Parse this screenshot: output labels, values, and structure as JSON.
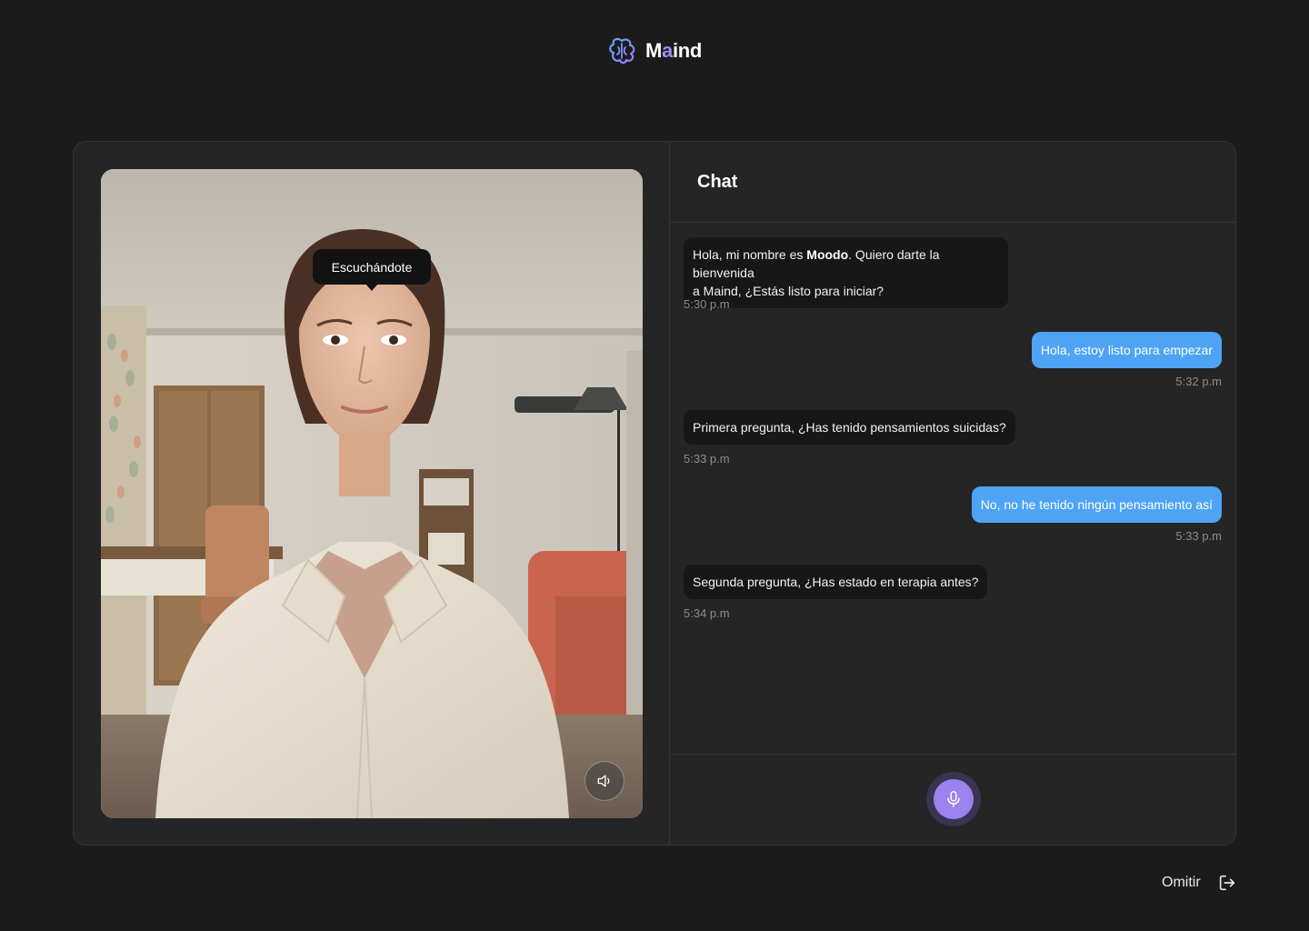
{
  "brand": {
    "name_pre": "M",
    "name_accent": "a",
    "name_mid": "i",
    "name_post": "nd",
    "accent_color": "#9b8cf6"
  },
  "video": {
    "status_tooltip": "Escuchándote",
    "volume_icon": "speaker-icon"
  },
  "chat": {
    "title": "Chat",
    "messages": [
      {
        "side": "in",
        "pre": "Hola, mi nombre es ",
        "bold": "Moodo",
        "post": ". Quiero darte la bienvenida",
        "line2": "a Maind, ¿Estás listo para iniciar?",
        "time": "5:30 p.m"
      },
      {
        "side": "out",
        "text": "Hola, estoy listo para empezar",
        "time": "5:32 p.m"
      },
      {
        "side": "in",
        "text": "Primera pregunta, ¿Has tenido pensamientos suicidas?",
        "time": "5:33 p.m"
      },
      {
        "side": "out",
        "text": "No, no he tenido ningún pensamiento así",
        "time": "5:33 p.m"
      },
      {
        "side": "in",
        "text": "Segunda pregunta, ¿Has estado en terapia antes?",
        "time": "5:34 p.m"
      }
    ],
    "mic_icon": "microphone-icon",
    "colors": {
      "incoming": "#171718",
      "outgoing": "#4ea3f5",
      "mic": "#9b82ee"
    }
  },
  "footer": {
    "skip_label": "Omitir",
    "skip_icon": "exit-icon"
  }
}
